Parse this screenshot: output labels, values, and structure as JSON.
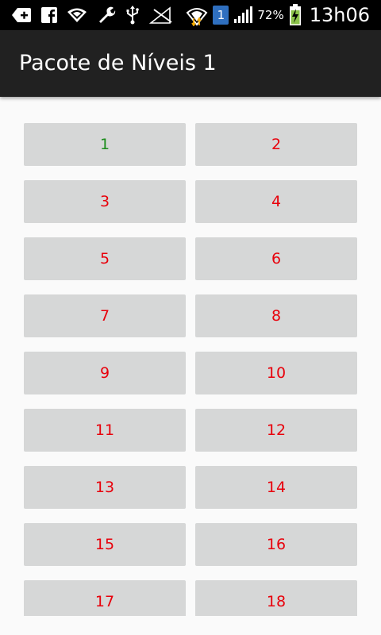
{
  "status_bar": {
    "icons_left": [
      "message-plus-icon",
      "facebook-icon",
      "wifi-icon",
      "wrench-icon",
      "usb-icon",
      "signal-off-icon"
    ],
    "wifi_data_icon": "wifi-data-icon",
    "sim_badge": "1",
    "signal_icon": "cell-signal-icon",
    "battery_percent": "72%",
    "battery_icon": "battery-charging-icon",
    "time": "13h06"
  },
  "app_bar": {
    "title": "Pacote de Níveis 1"
  },
  "levels": [
    {
      "label": "1",
      "color": "#1a8c1a",
      "completed": true
    },
    {
      "label": "2",
      "color": "#e8000b",
      "completed": false
    },
    {
      "label": "3",
      "color": "#e8000b",
      "completed": false
    },
    {
      "label": "4",
      "color": "#e8000b",
      "completed": false
    },
    {
      "label": "5",
      "color": "#e8000b",
      "completed": false
    },
    {
      "label": "6",
      "color": "#e8000b",
      "completed": false
    },
    {
      "label": "7",
      "color": "#e8000b",
      "completed": false
    },
    {
      "label": "8",
      "color": "#e8000b",
      "completed": false
    },
    {
      "label": "9",
      "color": "#e8000b",
      "completed": false
    },
    {
      "label": "10",
      "color": "#e8000b",
      "completed": false
    },
    {
      "label": "11",
      "color": "#e8000b",
      "completed": false
    },
    {
      "label": "12",
      "color": "#e8000b",
      "completed": false
    },
    {
      "label": "13",
      "color": "#e8000b",
      "completed": false
    },
    {
      "label": "14",
      "color": "#e8000b",
      "completed": false
    },
    {
      "label": "15",
      "color": "#e8000b",
      "completed": false
    },
    {
      "label": "16",
      "color": "#e8000b",
      "completed": false
    },
    {
      "label": "17",
      "color": "#e8000b",
      "completed": false
    },
    {
      "label": "18",
      "color": "#e8000b",
      "completed": false
    }
  ],
  "colors": {
    "status_bar_bg": "#000000",
    "app_bar_bg": "#212121",
    "page_bg": "#fafafa",
    "button_bg": "#d6d7d7",
    "completed_text": "#1a8c1a",
    "locked_text": "#e8000b",
    "battery_fill": "#8bc34a",
    "sim_badge_bg": "#2f6fbf"
  }
}
